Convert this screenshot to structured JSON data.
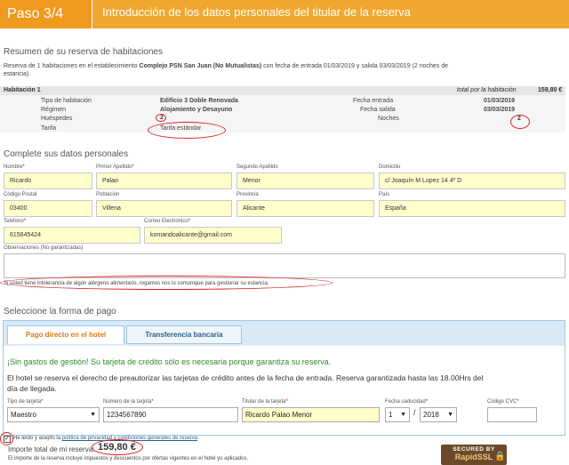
{
  "header": {
    "step": "Paso 3/4",
    "title": "Introducción de los datos personales del titular de la reserva"
  },
  "summary": {
    "title": "Resumen de su reserva de habitaciones",
    "text_prefix": "Reserva de 1 habitaciones en el establecimiento ",
    "hotel": "Complejo PSN San Juan (No Mutualistas)",
    "text_suffix_line1": " con fecha de entrada 01/03/2019 y salida 03/03/2019 (2 noches de",
    "text_line2": "estancia).",
    "room_label": "Habitación 1",
    "total_label": "total por la habitación",
    "total_value": "159,80 €",
    "rows": {
      "tipo_label": "Tipo de habitación",
      "tipo_value": "Edificio 3 Doble Renovada",
      "regimen_label": "Régimen",
      "regimen_value": "Alojamiento y Desayuno",
      "huespedes_label": "Huéspedes",
      "huespedes_value": "2",
      "tarifa_label": "Tarifa",
      "tarifa_value": "Tarifa estándar",
      "entrada_label": "Fecha entrada",
      "entrada_value": "01/03/2019",
      "salida_label": "Fecha salida",
      "salida_value": "03/03/2019",
      "noches_label": "Noches",
      "noches_value": "2"
    }
  },
  "form": {
    "title": "Complete sus datos personales",
    "nombre_label": "Nombre",
    "nombre_value": "Ricardo",
    "apellido1_label": "Primer Apellido",
    "apellido1_value": "Palao",
    "apellido2_label": "Segundo Apellido",
    "apellido2_value": "Menor",
    "domicilio_label": "Domicilio",
    "domicilio_value": "c/ Joaquín M Lopez 14 4º D",
    "cp_label": "Código Postal",
    "cp_value": "03400",
    "poblacion_label": "Población",
    "poblacion_value": "Villena",
    "provincia_label": "Provincia",
    "provincia_value": "Alicante",
    "pais_label": "País",
    "pais_value": "España",
    "telefono_label": "Teléfono",
    "telefono_value": "615845424",
    "email_label": "Correo Electrónico",
    "email_value": "komandoalicante@gmail.com",
    "obs_label": "Observaciones (No garantizadas)",
    "allergy_note": "Si usted tiene intolerancia de algún alérgeno alimentario, rogamos nos lo comunique para gestionar su estancia."
  },
  "payment": {
    "title": "Seleccione la forma de pago",
    "tab_direct": "Pago directo en el hotel",
    "tab_transfer": "Transferencia bancaria",
    "no_fees": "¡Sin gastos de gestión! Su tarjeta de crédito sólo es necesaria porque garantiza su reserva.",
    "preauth_line1": "El hotel se reserva el derecho de preautorizar las tarjetas de crédito antes de la fecha de entrada. Reserva garantizada hasta las 18.00Hrs del",
    "preauth_line2": "día de llegada.",
    "card_type_label": "Tipo de tarjeta",
    "card_type_value": "Maestro",
    "card_number_label": "Número de la tarjeta",
    "card_number_value": "1234567890",
    "holder_label": "Titular de la tarjeta",
    "holder_value": "Ricardo Palao Menor",
    "expiry_label": "Fecha caducidad",
    "expiry_month": "1",
    "expiry_sep": "/",
    "expiry_year": "2018",
    "cvc_label": "Código CVC"
  },
  "footer": {
    "accept_prefix": "He leído y acepto la ",
    "accept_link": "política de privacidad y condiciones generales de reserva",
    "total_label": "Importe total de mi reserva:",
    "total_value": "159,80 €",
    "disclaimer": "El importe de la reserva incluye impuestos y descuentos por ofertas vigentes en el hotel yo aplicados.",
    "badge_top": "SECURED BY",
    "badge_bottom": "RapidSSL"
  },
  "colors": {
    "header_orange": "#f0a830",
    "input_yellow": "#ffffcc",
    "required_red": "#cc0000",
    "annotation_red": "#dd2222",
    "green_text": "#2e8b2e"
  }
}
